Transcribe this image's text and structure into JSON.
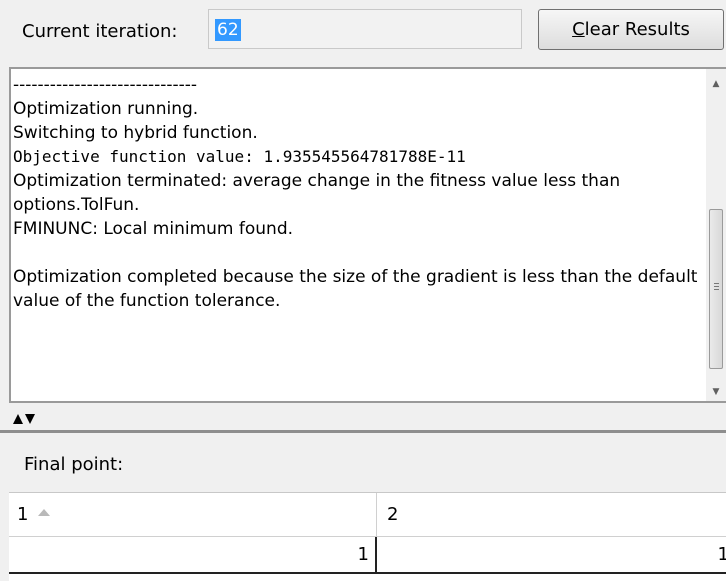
{
  "header": {
    "iteration_label": "Current iteration:",
    "iteration_value": "62",
    "clear_button": {
      "mnemonic": "C",
      "rest": "lear Results"
    }
  },
  "output": {
    "lines": [
      "------------------------------",
      "Optimization running.",
      "Switching to hybrid function.",
      "Objective function value: 1.935545564781788E-11",
      "Optimization terminated: average change in the fitness value less than options.TolFun.",
      "FMINUNC: Local minimum found.",
      "",
      "Optimization completed because the size of the gradient is less than the default value of the function tolerance."
    ]
  },
  "final_point": {
    "label": "Final point:",
    "columns": [
      "1",
      "2"
    ],
    "values": [
      "1",
      "1"
    ]
  },
  "icons": {
    "sort": "sort-ascending-icon",
    "splitter": "splitter-arrows-icon",
    "scroll_up": "scroll-up-icon",
    "scroll_down": "scroll-down-icon"
  },
  "colors": {
    "selection": "#3399ff",
    "panel_background": "#f0f0f0"
  }
}
